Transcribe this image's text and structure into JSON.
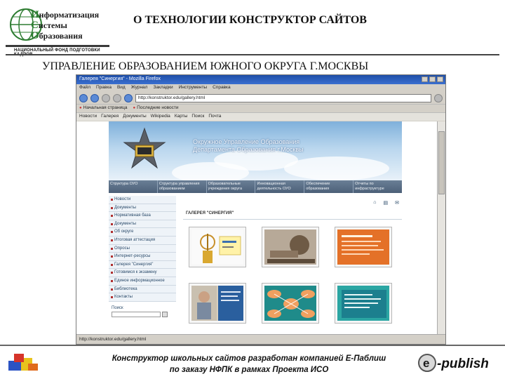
{
  "logo": {
    "lines": [
      "нформатизация",
      "истемы",
      "бразования"
    ],
    "caps": [
      "И",
      "С",
      "О"
    ],
    "subline": "НАЦИОНАЛЬНЫЙ ФОНД ПОДГОТОВКИ КАДРОВ"
  },
  "slide": {
    "title": "О ТЕХНОЛОГИИ КОНСТРУКТОР САЙТОВ",
    "subtitle": "УПРАВЛЕНИЕ ОБРАЗОВАНИЕМ ЮЖНОГО ОКРУГА Г.МОСКВЫ"
  },
  "browser": {
    "window_title": "Галерея \"Синергия\" - Mozilla Firefox",
    "menu": [
      "Файл",
      "Правка",
      "Вид",
      "Журнал",
      "Закладки",
      "Инструменты",
      "Справка"
    ],
    "url": "http://konstruktor.edu/gallery.html",
    "bookmarks": [
      "Начальная страница",
      "Последние новости"
    ],
    "tabs": [
      "Новости",
      "Галерея",
      "Документы",
      "Wikipedia",
      "Карты",
      "Поиск",
      "Почта"
    ],
    "status": "http://konstruktor.edu/gallery.html"
  },
  "page": {
    "banner_line1": "Окружное Управление Образования",
    "banner_line2": "Департамента Образования г.Москвы",
    "nav": [
      "Структура ОУО",
      "Структура управления образованием",
      "Образовательные учреждения округа",
      "Инновационная деятельность ОУО",
      "Обеспечение образования",
      "Отчеты по инфраструктуре"
    ],
    "sidebar": [
      "Новости",
      "Документы",
      "Нормативная база",
      "Документы",
      "Об округе",
      "Итоговая аттестация",
      "Опросы",
      "Интернет-ресурсы",
      "Галерея \"Синергия\"",
      "Готовимся к экзамену",
      "Единое информационное пространство",
      "Библиотека",
      "Контакты"
    ],
    "search_label": "Поиск",
    "gallery_title": "ГАЛЕРЕЯ \"СИНЕРГИЯ\"",
    "icons": [
      "home-icon",
      "print-icon",
      "mail-icon"
    ]
  },
  "footer": {
    "line1": "Конструктор школьных сайтов разработан компанией Е-Паблиш",
    "line2": "по заказу НФПК в рамках Проекта ИСО",
    "brand": "e-publish"
  },
  "colors": {
    "accent_blue": "#1f4fa8",
    "logo_green": "#2e7d32",
    "page_nav": "#4c6078",
    "thumb_orange": "#e06a1c",
    "thumb_teal": "#1f8b8a"
  }
}
